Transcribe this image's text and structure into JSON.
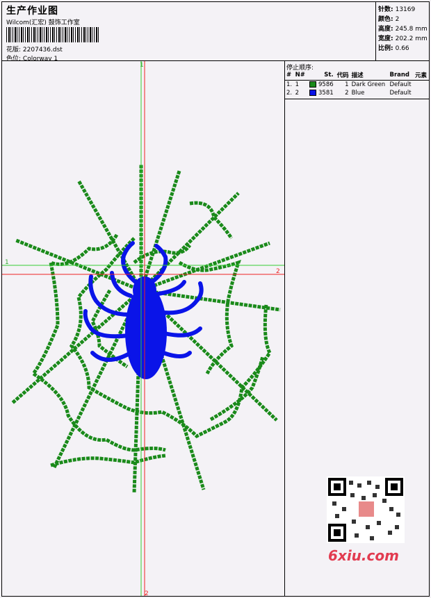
{
  "header": {
    "title": "生产作业图",
    "subtitle": "Wilcom(汇宏) 鼓饰工作室",
    "pattern_label": "花版:",
    "pattern_value": "2207436.dst",
    "colorway_label": "色位:",
    "colorway_value": "Colorway 1"
  },
  "stats": [
    {
      "label": "针数:",
      "value": "13169"
    },
    {
      "label": "颜色:",
      "value": "2"
    },
    {
      "label": "高度:",
      "value": "245.8 mm"
    },
    {
      "label": "宽度:",
      "value": "202.2 mm"
    },
    {
      "label": "比例:",
      "value": "0.66"
    }
  ],
  "sequence": {
    "title": "停止顺序:",
    "columns": [
      "#",
      "N#",
      "St.",
      "代码",
      "描述",
      "Brand",
      "元素"
    ],
    "rows": [
      {
        "idx": "1.",
        "n": "1",
        "st": "9586",
        "code": "1",
        "desc": "Dark Green",
        "brand": "Default",
        "color": "#1a8a1a"
      },
      {
        "idx": "2.",
        "n": "2",
        "st": "3581",
        "code": "2",
        "desc": "Blue",
        "brand": "Default",
        "color": "#0a14e8"
      }
    ]
  },
  "axes": {
    "v_top": "1",
    "v_bottom": "2",
    "h_left": "1",
    "h_right": "2"
  },
  "watermark": {
    "brand": "6xiu.com"
  },
  "colors": {
    "web": "#1a8a1a",
    "spider": "#0a14e8",
    "axis_v": "#33cc33",
    "axis_h": "#ee2222"
  }
}
